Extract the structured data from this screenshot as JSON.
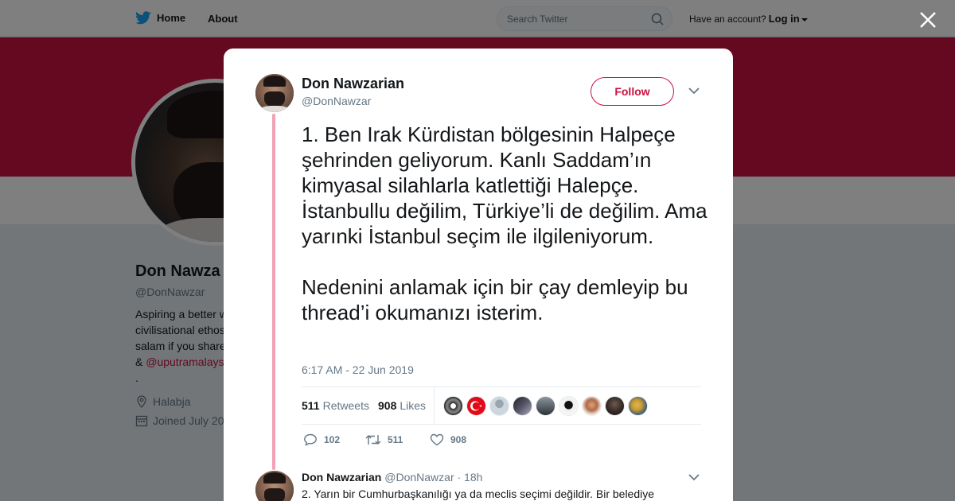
{
  "nav": {
    "home_label": "Home",
    "about_label": "About",
    "search_placeholder": "Search Twitter",
    "account_prompt": "Have an account?",
    "login_label": "Log in"
  },
  "colors": {
    "brand": "#c8133f",
    "twitter_blue": "#1da1f2"
  },
  "profile": {
    "name": "Don Nawzarian",
    "name_visible": "Don Nawza",
    "handle": "@DonNawzar",
    "bio_lines": [
      "Aspiring a better w",
      "civilisational ethos",
      "salam if you share",
      "& "
    ],
    "bio_link": "@uputramalays",
    "bio_end": ".",
    "location": "Halabja",
    "joined": "Joined July 20"
  },
  "tweet": {
    "author_name": "Don Nawzarian",
    "author_handle": "@DonNawzar",
    "follow_label": "Follow",
    "text": "1. Ben Irak Kürdistan bölgesinin Halpeçe şehrinden geliyorum. Kanlı Saddam’ın kimyasal silahlarla katlettiği Halepçe. İstanbullu değilim, Türkiye’li de değilim. Ama yarınki İstanbul seçim ile ilgileniyorum.\n\nNedenini anlamak için bir çay demleyip bu thread’i okumanızı isterim.",
    "timestamp": "6:17 AM - 22 Jun 2019",
    "retweets_count": "511",
    "retweets_label": "Retweets",
    "likes_count": "908",
    "likes_label": "Likes",
    "actions": {
      "replies": "102",
      "retweets": "511",
      "likes": "908"
    }
  },
  "reply": {
    "author_name": "Don Nawzarian",
    "author_handle": "@DonNawzar",
    "time": "· 18h",
    "text": "2. Yarın bir Cumhurbaşkanılığı ya da meclis seçimi değildir. Bir belediye"
  }
}
